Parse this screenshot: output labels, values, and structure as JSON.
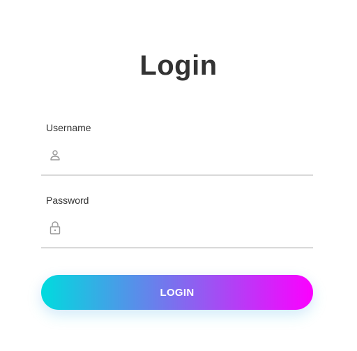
{
  "page": {
    "title": "Login"
  },
  "form": {
    "username": {
      "label": "Username",
      "value": "",
      "icon": "user-icon"
    },
    "password": {
      "label": "Password",
      "value": "",
      "icon": "lock-icon"
    },
    "submit_label": "LOGIN"
  },
  "colors": {
    "title": "#333333",
    "label": "#333333",
    "underline": "#d9d9d9",
    "icon": "#999999",
    "button_gradient_start": "#00dbde",
    "button_gradient_end": "#fc00ff",
    "button_text": "#ffffff"
  }
}
